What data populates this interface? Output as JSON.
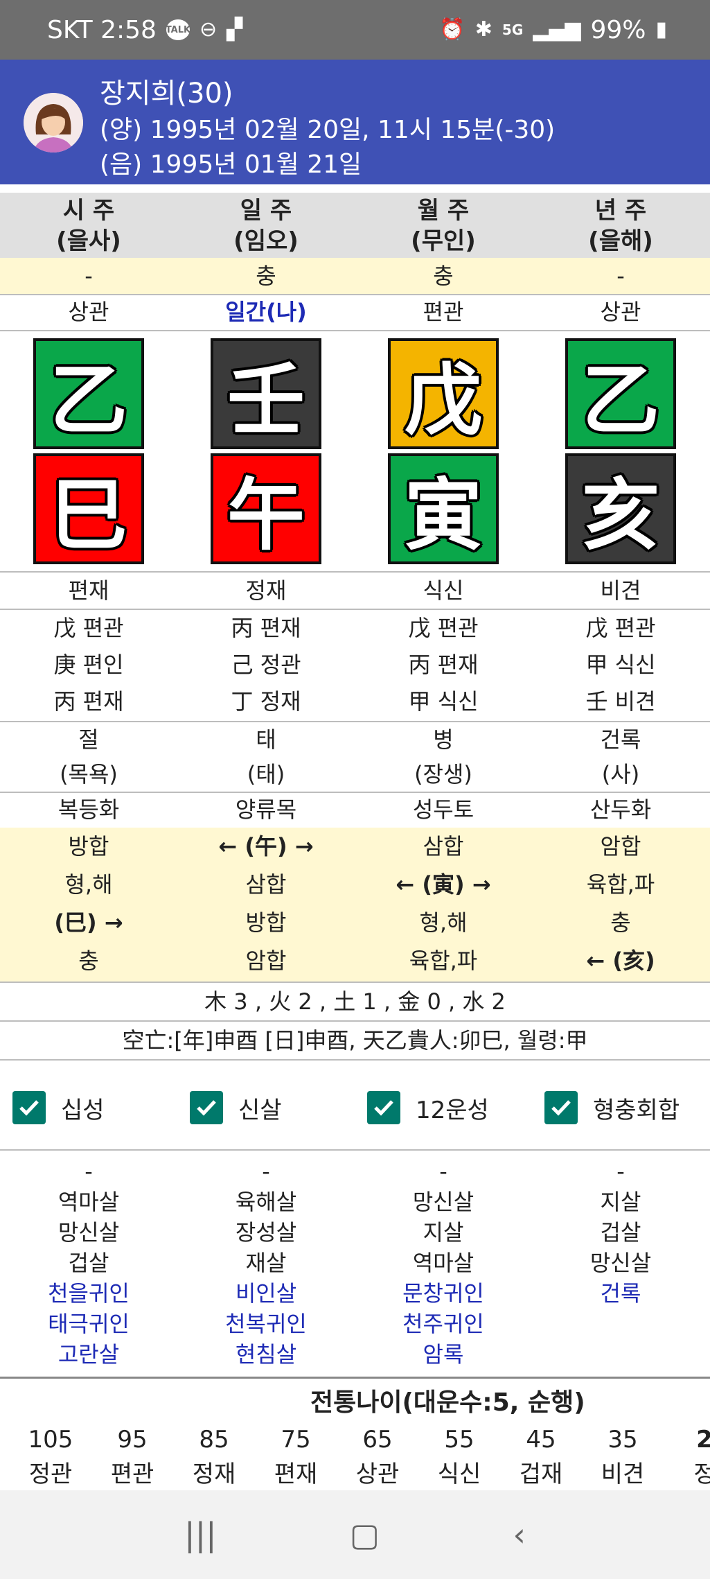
{
  "status": {
    "carrier_time": "SKT 2:58",
    "talk": "TALK",
    "net": "5G",
    "battery": "99%"
  },
  "profile": {
    "name": "장지희(30)",
    "solar": "(양) 1995년 02월 20일, 11시 15분(-30)",
    "lunar": "(음) 1995년 01월 21일"
  },
  "pillars": {
    "headers": [
      {
        "name": "시 주",
        "sub": "(을사)"
      },
      {
        "name": "일 주",
        "sub": "(임오)"
      },
      {
        "name": "월 주",
        "sub": "(무인)"
      },
      {
        "name": "년 주",
        "sub": "(을해)"
      }
    ],
    "chung": [
      "-",
      "충",
      "충",
      "-"
    ],
    "sipsung_top": [
      "상관",
      "일간(나)",
      "편관",
      "상관"
    ],
    "cheongan": [
      "乙",
      "壬",
      "戊",
      "乙"
    ],
    "jiji": [
      "巳",
      "午",
      "寅",
      "亥"
    ],
    "sipsung_bottom": [
      "편재",
      "정재",
      "식신",
      "비견"
    ],
    "janggan": [
      [
        "戊 편관",
        "庚 편인",
        "丙 편재"
      ],
      [
        "丙 편재",
        "己 정관",
        "丁 정재"
      ],
      [
        "戊 편관",
        "丙 편재",
        "甲 식신"
      ],
      [
        "戊 편관",
        "甲 식신",
        "壬 비견"
      ]
    ],
    "unsung": [
      [
        "절",
        "(목욕)"
      ],
      [
        "태",
        "(태)"
      ],
      [
        "병",
        "(장생)"
      ],
      [
        "건록",
        "(사)"
      ]
    ],
    "napeum": [
      "복등화",
      "양류목",
      "성두토",
      "산두화"
    ],
    "hab": [
      [
        "방합",
        "형,해",
        "(巳) →",
        "충"
      ],
      [
        "← (午) →",
        "삼합",
        "방합",
        "암합"
      ],
      [
        "삼합",
        "← (寅) →",
        "형,해",
        "육합,파"
      ],
      [
        "암합",
        "육합,파",
        "충",
        "← (亥)"
      ]
    ]
  },
  "ohaeng": "木 3 , 火 2 , 土 1 , 金 0 , 水 2",
  "gongmang": "空亡:[年]申酉 [日]申酉, 天乙貴人:卯巳, 월령:甲",
  "checks": [
    {
      "label": "십성",
      "checked": true
    },
    {
      "label": "신살",
      "checked": true
    },
    {
      "label": "12운성",
      "checked": true
    },
    {
      "label": "형충회합",
      "checked": true
    }
  ],
  "sinsal": [
    {
      "black": [
        "-",
        "역마살",
        "망신살",
        "겁살"
      ],
      "blue": [
        "천을귀인",
        "태극귀인",
        "고란살"
      ]
    },
    {
      "black": [
        "-",
        "육해살",
        "장성살",
        "재살"
      ],
      "blue": [
        "비인살",
        "천복귀인",
        "현침살"
      ]
    },
    {
      "black": [
        "-",
        "망신살",
        "지살",
        "역마살"
      ],
      "blue": [
        "문창귀인",
        "천주귀인",
        "암록"
      ]
    },
    {
      "black": [
        "-",
        "지살",
        "겁살",
        "망신살"
      ],
      "blue": [
        "건록"
      ]
    }
  ],
  "daeun": {
    "title": "전통나이(대운수:5, 순행)",
    "ages": [
      "105",
      "95",
      "85",
      "75",
      "65",
      "55",
      "45",
      "35",
      "2"
    ],
    "labels": [
      "정관",
      "편관",
      "정재",
      "편재",
      "상관",
      "식신",
      "겁재",
      "비견",
      "정"
    ]
  },
  "colors": {
    "header_bg": "#3f51b5",
    "wood": "#0aa74a",
    "water": "#3a3a3a",
    "earth": "#f4b400",
    "fire": "#ff0000",
    "check": "#00796b",
    "accent_blue": "#1e2bb5"
  }
}
